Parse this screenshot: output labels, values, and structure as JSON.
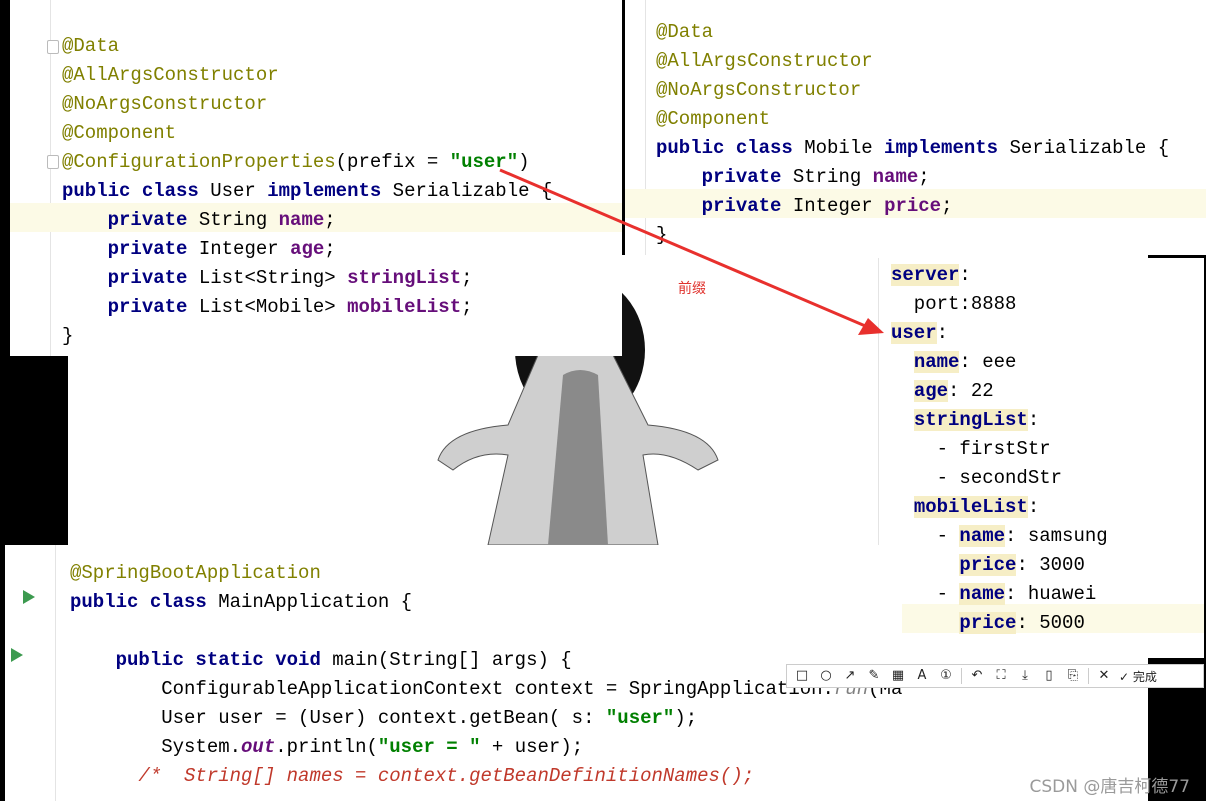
{
  "user_panel": {
    "lines": [
      "",
      "<span class=\"ann\">@Data</span>",
      "<span class=\"ann\">@AllArgsConstructor</span>",
      "<span class=\"ann\">@NoArgsConstructor</span>",
      "<span class=\"ann\">@Component</span>",
      "<span class=\"ann\">@ConfigurationProperties</span>(prefix = <span class=\"str\">\"user\"</span>)",
      "<span class=\"kw\">public class</span> User <span class=\"kw\">implements</span> Serializable {",
      "    <span class=\"kw\">private</span> String <span class=\"fld\">name</span>;",
      "    <span class=\"kw\">private</span> Integer <span class=\"fld\">age</span>;",
      "    <span class=\"kw\">private</span> List&lt;String&gt; <span class=\"fld\">stringList</span>;",
      "    <span class=\"kw\">private</span> List&lt;Mobile&gt; <span class=\"fld\">mobileList</span>;",
      "}"
    ]
  },
  "mobile_panel": {
    "lines": [
      "<span class=\"ann\">@Data</span>",
      "<span class=\"ann\">@AllArgsConstructor</span>",
      "<span class=\"ann\">@NoArgsConstructor</span>",
      "<span class=\"ann\">@Component</span>",
      "<span class=\"kw\">public class</span> Mobile <span class=\"kw\">implements</span> Serializable {",
      "    <span class=\"kw\">private</span> String <span class=\"fld\">name</span>;",
      "    <span class=\"kw\">private</span> Integer <span class=\"fld\">price</span>;",
      "}"
    ]
  },
  "yaml_panel": {
    "lines": [
      "<span class=\"key\">server</span>:",
      "  port:8888",
      "<span class=\"key\">user</span>:",
      "  <span class=\"key\">name</span>: eee",
      "  <span class=\"key\">age</span>: 22",
      "  <span class=\"key\">stringList</span>:",
      "    - firstStr",
      "    - secondStr",
      "  <span class=\"key\">mobileList</span>:",
      "    - <span class=\"key\">name</span>: samsung",
      "      <span class=\"key\">price</span>: 3000",
      "    - <span class=\"key\">name</span>: huawei",
      "      <span class=\"key\">price</span>: 5000"
    ]
  },
  "main_panel": {
    "lines": [
      "<span class=\"ann\">@SpringBootApplication</span>",
      "<span class=\"kw\">public class</span> MainApplication {",
      "",
      "    <span class=\"kw\">public static void</span> main(String[] args) {",
      "        ConfigurableApplicationContext context = SpringApplication.<span class=\"cm\">run</span>(MainA",
      "        User user = (User) context.getBean( s: <span class=\"str\">\"user\"</span>);",
      "        System.<span class=\"ital\">out</span>.println(<span class=\"str\">\"user = \"</span> + user);",
      "      <span class=\"cm\" style=\"color:#c0392b\">/*  String[] names = context.getBeanDefinitionNames();</span>"
    ]
  },
  "annotation": {
    "prefix_label": "前缀"
  },
  "toolbar": {
    "icons": [
      "rectangle-icon",
      "circle-icon",
      "arrow-icon",
      "pen-icon",
      "mosaic-icon",
      "text-icon",
      "number-icon",
      "undo-icon",
      "crop-icon",
      "download-icon",
      "pin-icon",
      "save-icon",
      "close-icon"
    ],
    "done_label": "完成"
  },
  "watermark": "CSDN @唐吉柯德77"
}
